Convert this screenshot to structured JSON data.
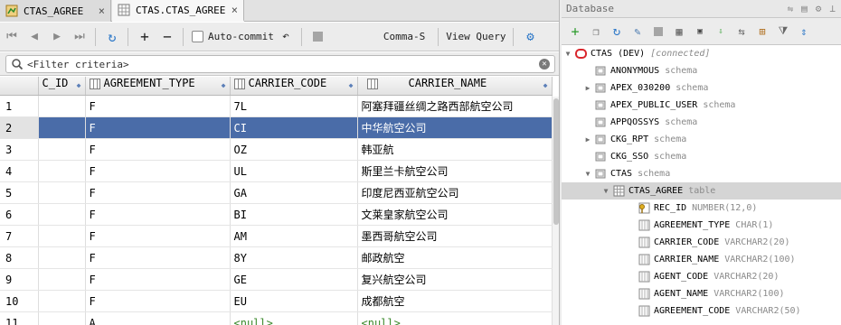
{
  "tabs": [
    {
      "label": "CTAS_AGREE",
      "active": false
    },
    {
      "label": "CTAS.CTAS_AGREE",
      "active": true
    }
  ],
  "toolbar": {
    "autocommit_label": "Auto-commit",
    "format_label": "Comma-S",
    "view_query_label": "View Query"
  },
  "filter": {
    "placeholder": "<Filter criteria>"
  },
  "grid": {
    "columns": [
      "C_ID",
      "AGREEMENT_TYPE",
      "CARRIER_CODE",
      "CARRIER_NAME"
    ],
    "rows": [
      {
        "n": "1",
        "c_id": "",
        "type": "F",
        "code": "7L",
        "name": "阿塞拜疆丝绸之路西部航空公司"
      },
      {
        "n": "2",
        "c_id": "",
        "type": "F",
        "code": "CI",
        "name": "中华航空公司"
      },
      {
        "n": "3",
        "c_id": "",
        "type": "F",
        "code": "OZ",
        "name": "韩亚航"
      },
      {
        "n": "4",
        "c_id": "",
        "type": "F",
        "code": "UL",
        "name": "斯里兰卡航空公司"
      },
      {
        "n": "5",
        "c_id": "",
        "type": "F",
        "code": "GA",
        "name": "印度尼西亚航空公司"
      },
      {
        "n": "6",
        "c_id": "",
        "type": "F",
        "code": "BI",
        "name": "文莱皇家航空公司"
      },
      {
        "n": "7",
        "c_id": "",
        "type": "F",
        "code": "AM",
        "name": "墨西哥航空公司"
      },
      {
        "n": "8",
        "c_id": "",
        "type": "F",
        "code": "8Y",
        "name": "邮政航空"
      },
      {
        "n": "9",
        "c_id": "",
        "type": "F",
        "code": "GE",
        "name": "复兴航空公司"
      },
      {
        "n": "10",
        "c_id": "",
        "type": "F",
        "code": "EU",
        "name": "成都航空"
      },
      {
        "n": "11",
        "c_id": "",
        "type": "A",
        "code": "<null>",
        "name": "<null>"
      }
    ],
    "selected_row": "2"
  },
  "database": {
    "title": "Database",
    "connection": {
      "name": "CTAS (DEV)",
      "status": "[connected]"
    },
    "schemas": [
      {
        "name": "ANONYMOUS",
        "type": "schema"
      },
      {
        "name": "APEX_030200",
        "type": "schema"
      },
      {
        "name": "APEX_PUBLIC_USER",
        "type": "schema"
      },
      {
        "name": "APPQOSSYS",
        "type": "schema"
      },
      {
        "name": "CKG_RPT",
        "type": "schema"
      },
      {
        "name": "CKG_SSO",
        "type": "schema"
      },
      {
        "name": "CTAS",
        "type": "schema"
      }
    ],
    "table": {
      "name": "CTAS_AGREE",
      "type": "table"
    },
    "columns": [
      {
        "name": "REC_ID",
        "type": "NUMBER(12,0)"
      },
      {
        "name": "AGREEMENT_TYPE",
        "type": "CHAR(1)"
      },
      {
        "name": "CARRIER_CODE",
        "type": "VARCHAR2(20)"
      },
      {
        "name": "CARRIER_NAME",
        "type": "VARCHAR2(100)"
      },
      {
        "name": "AGENT_CODE",
        "type": "VARCHAR2(20)"
      },
      {
        "name": "AGENT_NAME",
        "type": "VARCHAR2(100)"
      },
      {
        "name": "AGREEMENT_CODE",
        "type": "VARCHAR2(50)"
      }
    ]
  },
  "colors": {
    "selection": "#4a6ca8",
    "null_value": "#3b8a2c",
    "connection_icon": "#d9262c"
  }
}
